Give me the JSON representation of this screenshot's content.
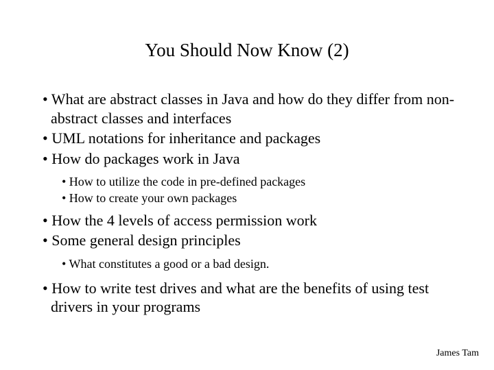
{
  "title": "You Should Now Know (2)",
  "bullets": {
    "b1": "• What are abstract classes in Java and how do they differ from non-abstract classes and interfaces",
    "b2": "• UML notations for inheritance and packages",
    "b3": "• How do packages work in Java",
    "b3_sub1": "• How to utilize the code in pre-defined packages",
    "b3_sub2": "• How to create your own packages",
    "b4": "• How the 4 levels of access permission work",
    "b5": "• Some general design principles",
    "b5_sub1": "• What constitutes a good or a bad design.",
    "b6": "• How to write test drives and what are the benefits of using test drivers in your programs"
  },
  "footer": "James Tam"
}
